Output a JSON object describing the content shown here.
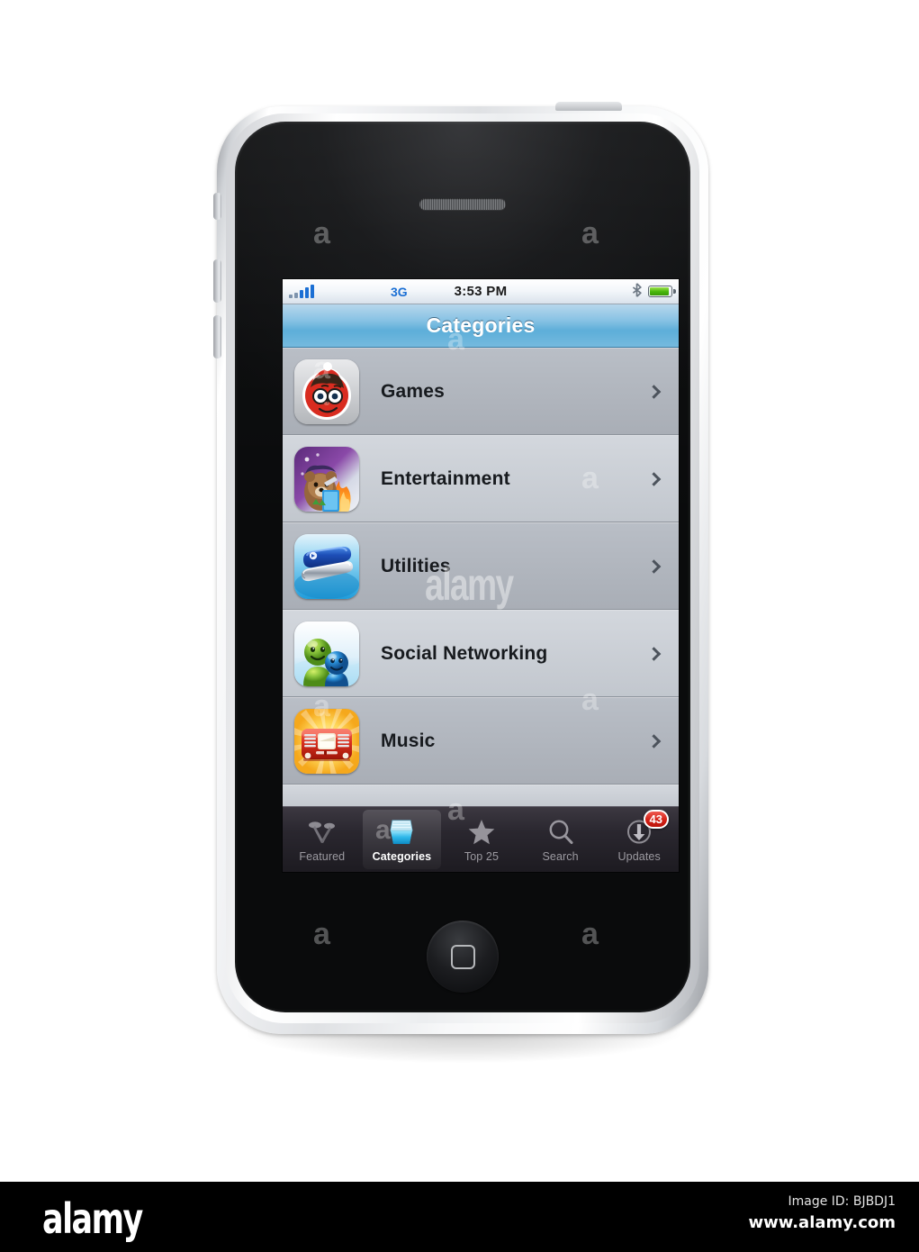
{
  "status_bar": {
    "signal_label": "signal-bars",
    "network": "3G",
    "time": "3:53 PM",
    "bluetooth_glyph": "✶",
    "battery_level": "93"
  },
  "nav": {
    "title": "Categories"
  },
  "categories": [
    {
      "label": "Games",
      "icon": "waldo-icon",
      "shade": "dark"
    },
    {
      "label": "Entertainment",
      "icon": "entertainment-icon",
      "shade": "light"
    },
    {
      "label": "Utilities",
      "icon": "pocketknife-icon",
      "shade": "dark"
    },
    {
      "label": "Social Networking",
      "icon": "smiley-people-icon",
      "shade": "light"
    },
    {
      "label": "Music",
      "icon": "radio-icon",
      "shade": "dark"
    }
  ],
  "tabs": [
    {
      "label": "Featured",
      "icon": "spotlight-icon",
      "active": false,
      "badge": ""
    },
    {
      "label": "Categories",
      "icon": "open-box-icon",
      "active": true,
      "badge": ""
    },
    {
      "label": "Top 25",
      "icon": "star-icon",
      "active": false,
      "badge": ""
    },
    {
      "label": "Search",
      "icon": "magnifier-icon",
      "active": false,
      "badge": ""
    },
    {
      "label": "Updates",
      "icon": "download-arrow-icon",
      "active": false,
      "badge": "43"
    }
  ],
  "footer": {
    "logo": "alamy",
    "image_id": "Image ID: BJBDJ1",
    "url": "www.alamy.com"
  },
  "watermark": {
    "letter": "a",
    "word": "alamy"
  },
  "colors": {
    "accent_blue": "#1b6fd4",
    "titlebar_blue": "#5daed9",
    "badge_red": "#d32015",
    "battery_green": "#49b80d",
    "row_dark": "#b9bec6",
    "row_light": "#d3d7dd"
  }
}
